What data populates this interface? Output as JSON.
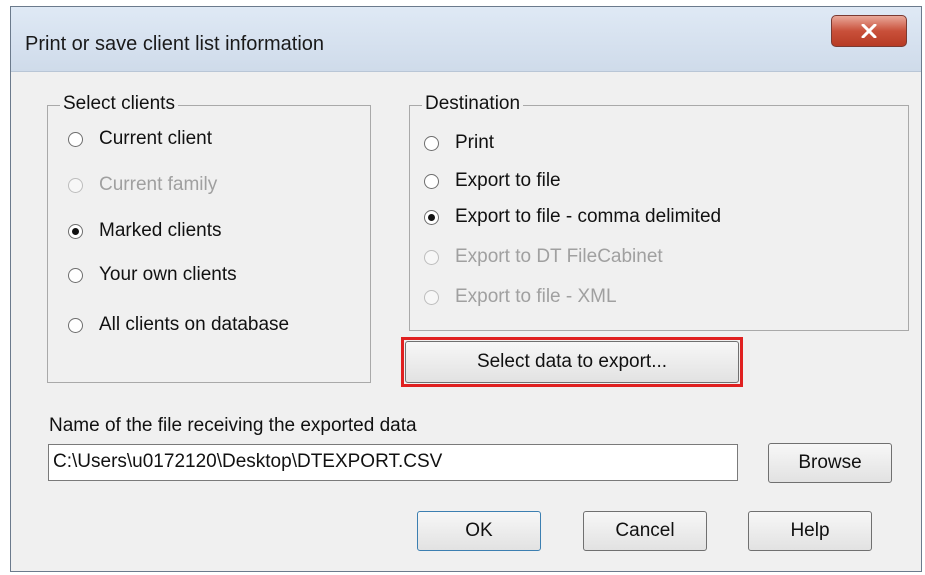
{
  "dialog": {
    "title": "Print or save client list information",
    "close_label": "X"
  },
  "select_clients": {
    "legend": "Select clients",
    "options": [
      {
        "label": "Current client",
        "checked": false,
        "disabled": false
      },
      {
        "label": "Current family",
        "checked": false,
        "disabled": true
      },
      {
        "label": "Marked clients",
        "checked": true,
        "disabled": false
      },
      {
        "label": "Your own clients",
        "checked": false,
        "disabled": false
      },
      {
        "label": "All clients on database",
        "checked": false,
        "disabled": false
      }
    ]
  },
  "destination": {
    "legend": "Destination",
    "options": [
      {
        "label": "Print",
        "checked": false,
        "disabled": false
      },
      {
        "label": "Export to file",
        "checked": false,
        "disabled": false
      },
      {
        "label": "Export to file - comma delimited",
        "checked": true,
        "disabled": false
      },
      {
        "label": "Export to DT FileCabinet",
        "checked": false,
        "disabled": true
      },
      {
        "label": "Export to file - XML",
        "checked": false,
        "disabled": true
      }
    ]
  },
  "select_data_button": "Select data to export...",
  "file": {
    "label": "Name of the file receiving the exported data",
    "value": "C:\\Users\\u0172120\\Desktop\\DTEXPORT.CSV",
    "browse_label": "Browse"
  },
  "footer": {
    "ok_label": "OK",
    "cancel_label": "Cancel",
    "help_label": "Help"
  },
  "colors": {
    "highlight": "#e02020",
    "close_button": "#c9503a"
  }
}
